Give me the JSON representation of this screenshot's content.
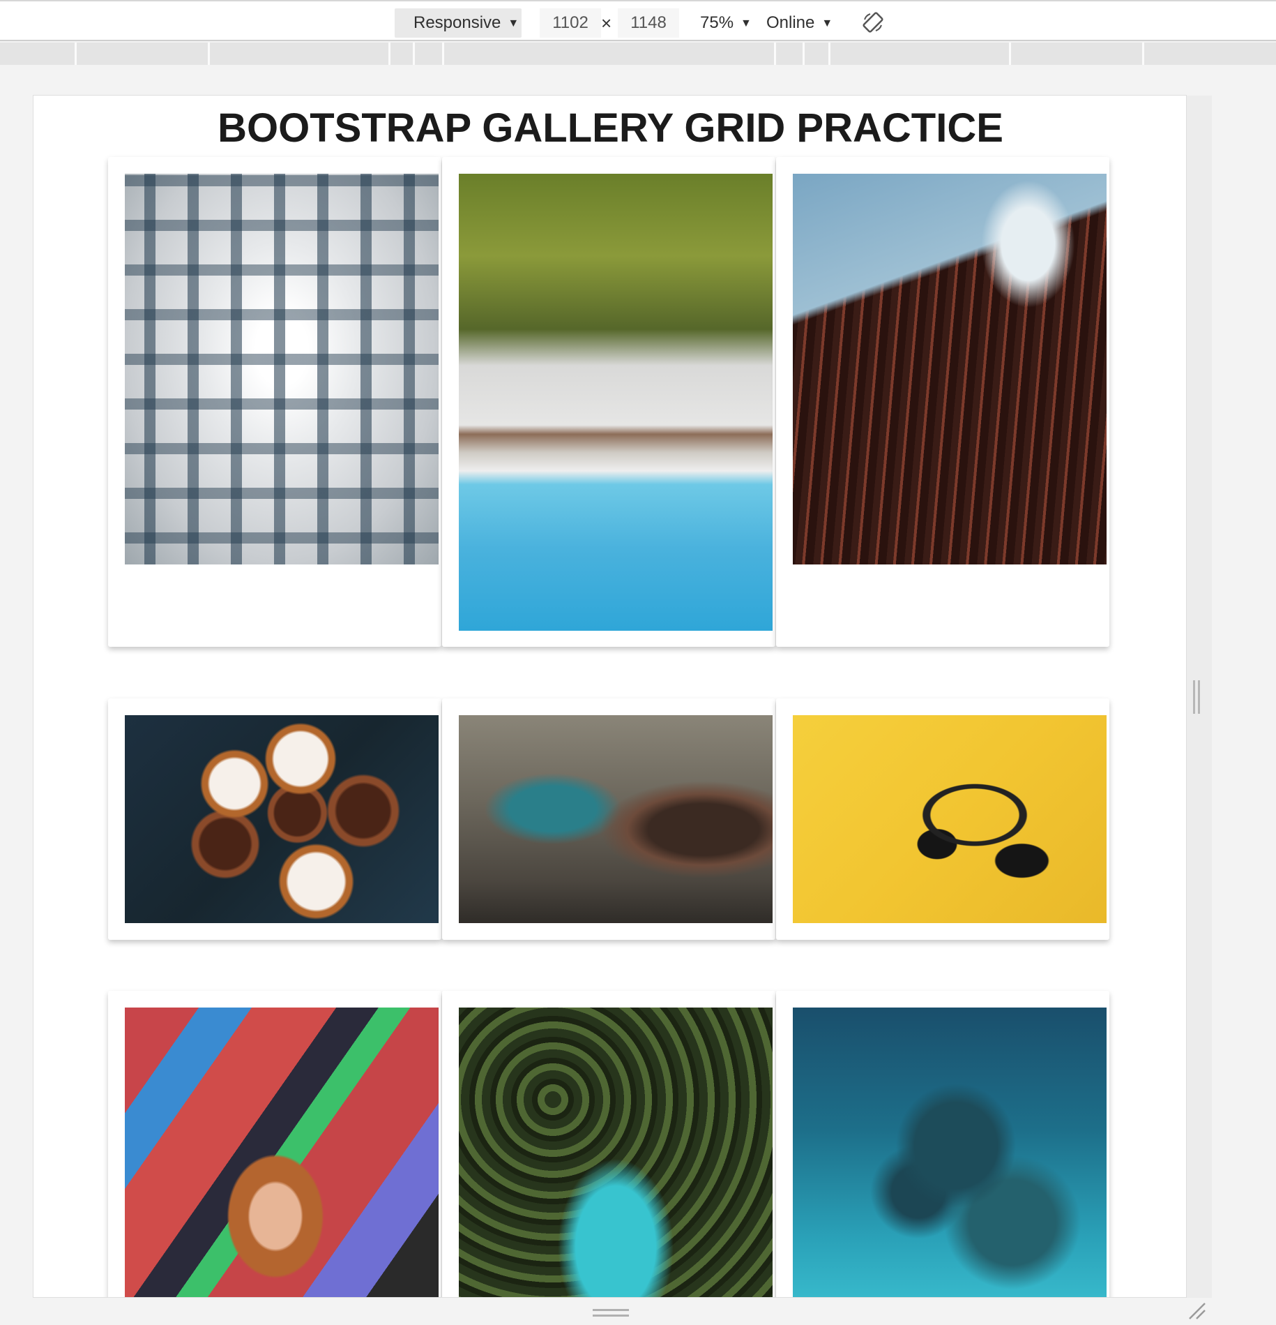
{
  "devtools": {
    "device": "Responsive",
    "width": "1102",
    "times": "×",
    "height": "1148",
    "zoom": "75%",
    "network": "Online",
    "caret": "▼",
    "rotate_icon": "rotate-icon"
  },
  "page": {
    "title": "BOOTSTRAP GALLERY GRID PRACTICE"
  },
  "gallery": {
    "photos": [
      {
        "subject": "building",
        "alt": ""
      },
      {
        "subject": "beach",
        "alt": ""
      },
      {
        "subject": "curve",
        "alt": ""
      },
      {
        "subject": "cupcakes",
        "alt": ""
      },
      {
        "subject": "graffiti",
        "alt": ""
      },
      {
        "subject": "headphones",
        "alt": ""
      },
      {
        "subject": "girl",
        "alt": ""
      },
      {
        "subject": "palms",
        "alt": ""
      },
      {
        "subject": "reef",
        "alt": ""
      }
    ]
  }
}
